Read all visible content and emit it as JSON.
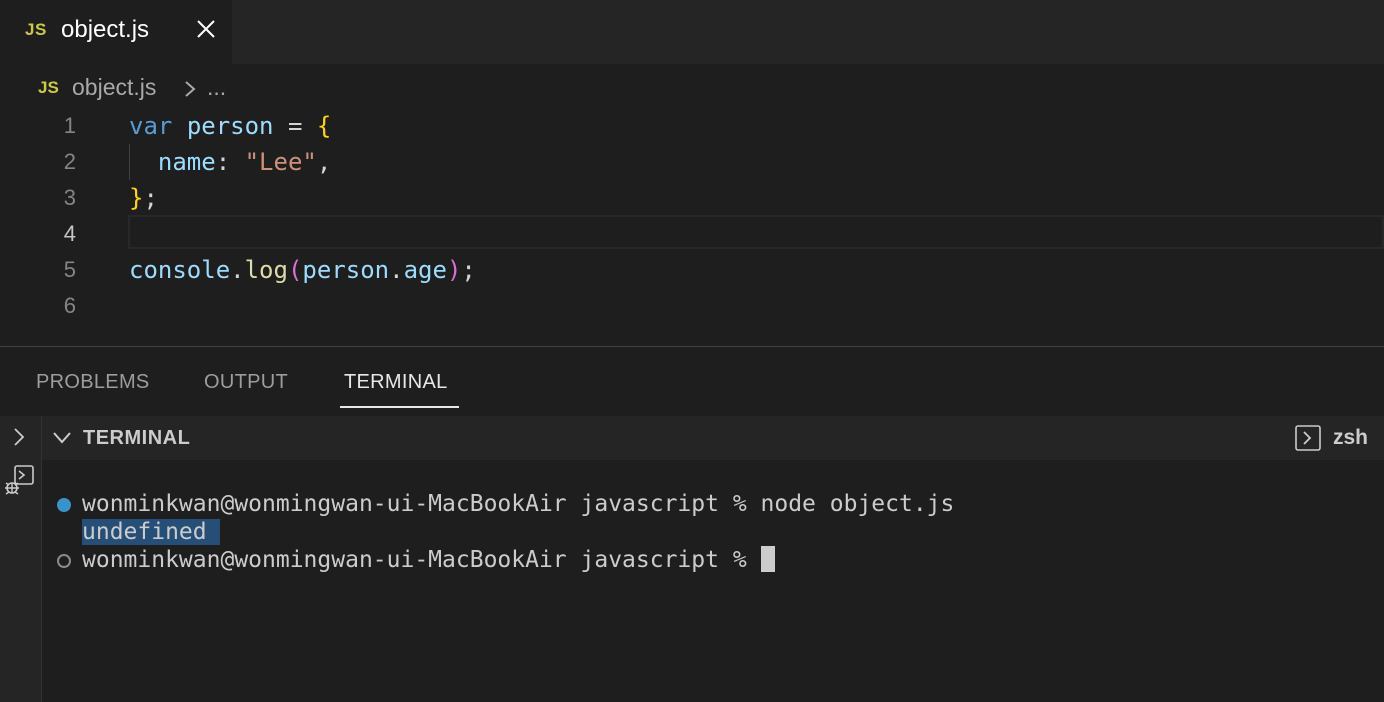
{
  "tab": {
    "icon_label": "JS",
    "title": "object.js",
    "close_icon": "close-icon"
  },
  "breadcrumb": {
    "icon_label": "JS",
    "file": "object.js",
    "more": "..."
  },
  "editor": {
    "active_line": 4,
    "lines": [
      {
        "number": "1",
        "text": "var person = {"
      },
      {
        "number": "2",
        "text": "  name: \"Lee\","
      },
      {
        "number": "3",
        "text": "};"
      },
      {
        "number": "4",
        "text": ""
      },
      {
        "number": "5",
        "text": "console.log(person.age);"
      },
      {
        "number": "6",
        "text": ""
      }
    ]
  },
  "panel": {
    "tabs": [
      "PROBLEMS",
      "OUTPUT",
      "TERMINAL"
    ],
    "active_tab": "TERMINAL"
  },
  "terminal": {
    "header_title": "TERMINAL",
    "shell": "zsh",
    "lines": [
      "wonminkwan@wonmingwan-ui-MacBookAir javascript % node object.js",
      "undefined ",
      "wonminkwan@wonmingwan-ui-MacBookAir javascript % "
    ]
  },
  "colors": {
    "accent_js": "#cbcb41",
    "keyword": "#569cd6",
    "variable": "#9cdcfe",
    "string": "#ce9178",
    "function": "#dcdcaa",
    "bracket": "#ffd700",
    "selection": "#264f78",
    "prompt_dot": "#3794c9"
  }
}
